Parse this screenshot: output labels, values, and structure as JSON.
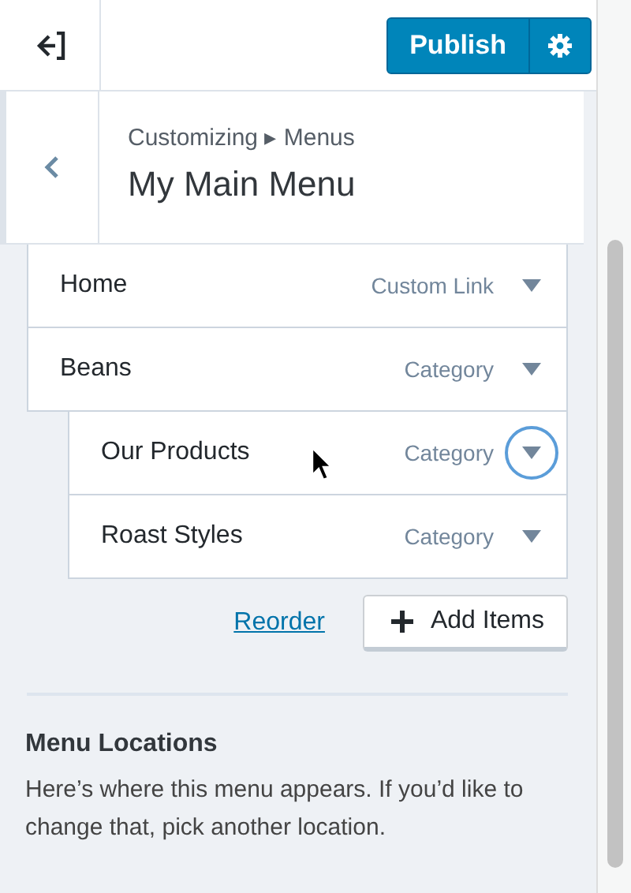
{
  "header": {
    "publish_label": "Publish"
  },
  "section": {
    "breadcrumb": "Customizing ▸ Menus",
    "title": "My Main Menu"
  },
  "menu_items": [
    {
      "title": "Home",
      "type": "Custom Link",
      "focused": false
    },
    {
      "title": "Beans",
      "type": "Category",
      "focused": false,
      "children": [
        {
          "title": "Our Products",
          "type": "Category",
          "focused": true
        },
        {
          "title": "Roast Styles",
          "type": "Category",
          "focused": false
        }
      ]
    }
  ],
  "actions": {
    "reorder": "Reorder",
    "add_items": "Add Items"
  },
  "locations": {
    "heading": "Menu Locations",
    "description": "Here’s where this menu appears. If you’d like to change that, pick another location."
  }
}
